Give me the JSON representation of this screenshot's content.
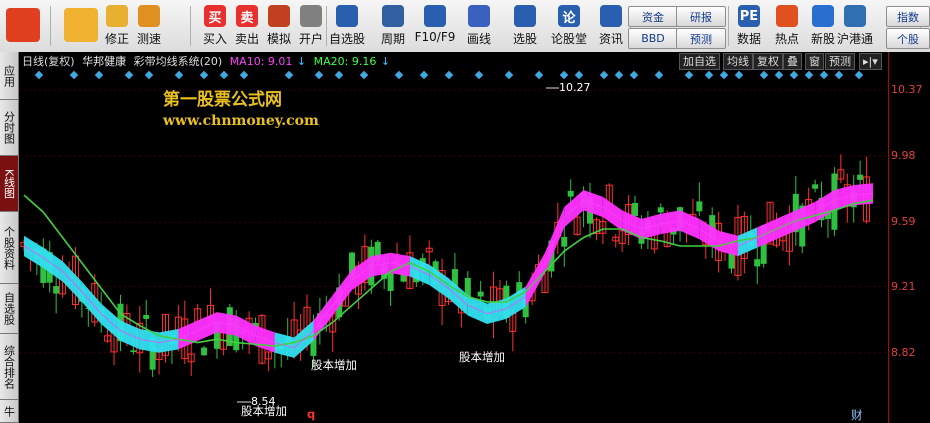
{
  "toolbar": {
    "buttons": [
      {
        "label": "",
        "icon": "app-grid-icon"
      },
      {
        "label": "",
        "icon": "back-arrow-icon"
      },
      {
        "label": "修正",
        "icon": "up-down-icon"
      },
      {
        "label": "测速",
        "icon": "speed-icon"
      },
      {
        "label": "买入",
        "icon": "buy-icon",
        "glyph": "买"
      },
      {
        "label": "卖出",
        "icon": "sell-icon",
        "glyph": "卖"
      },
      {
        "label": "模拟",
        "icon": "hammer-icon"
      },
      {
        "label": "开户",
        "icon": "lock-icon"
      },
      {
        "label": "自选股",
        "icon": "star-icon"
      },
      {
        "label": "周期",
        "icon": "clock-icon"
      },
      {
        "label": "F10/F9",
        "icon": "f10-icon"
      },
      {
        "label": "画线",
        "icon": "pen-icon"
      },
      {
        "label": "选股",
        "icon": "select-stock-icon"
      },
      {
        "label": "论股堂",
        "icon": "forum-icon",
        "glyph": "论"
      },
      {
        "label": "资讯",
        "icon": "news-icon"
      },
      {
        "label": "数据",
        "icon": "pe-icon",
        "glyph": "PE"
      },
      {
        "label": "热点",
        "icon": "hot-icon"
      },
      {
        "label": "新股",
        "icon": "new-stock-icon"
      },
      {
        "label": "沪港通",
        "icon": "sse-hkex-icon"
      }
    ],
    "small_buttons": [
      "资金",
      "BBD",
      "研报",
      "预测",
      "指数",
      "个股"
    ]
  },
  "left_tabs": [
    "应用",
    "分时图",
    "K线图",
    "个股资料",
    "自选股",
    "综合排名",
    "牛"
  ],
  "chart_header": {
    "period": "日线(复权)",
    "stock": "华邦健康",
    "indicator": "彩带均线系统(20)",
    "ma10_label": "MA10: 9.01",
    "ma10_arrow": "↓",
    "ma20_label": "MA20: 9.16",
    "ma20_arrow": "↓",
    "right_buttons": [
      "加自选",
      "均线",
      "复权",
      "叠",
      "窗",
      "预测"
    ],
    "colors": {
      "ma10": "#ff40ff",
      "ma20": "#40ff40",
      "up": "#ff3030",
      "down": "#00c8c8"
    }
  },
  "watermark": {
    "line1": "第一股票公式网",
    "line2": "www.chnmoney.com"
  },
  "annotations": {
    "high_label": "10.27",
    "low_label": "8.54",
    "event1": "股本增加",
    "event2": "股本增加",
    "event3": "股本增加",
    "bottom_q": "q",
    "bottom_cai": "财"
  },
  "chart_data": {
    "type": "line",
    "ylim": [
      8.5,
      10.5
    ],
    "y_ticks": [
      10.37,
      9.98,
      9.59,
      9.21,
      8.82
    ],
    "series": [
      {
        "name": "MA10",
        "values": [
          9.45,
          9.38,
          9.3,
          9.18,
          9.05,
          8.95,
          8.9,
          8.88,
          8.9,
          8.95,
          9.0,
          8.98,
          8.92,
          8.88,
          8.85,
          8.95,
          9.1,
          9.25,
          9.33,
          9.35,
          9.33,
          9.28,
          9.2,
          9.1,
          9.05,
          9.08,
          9.15,
          9.35,
          9.62,
          9.72,
          9.68,
          9.6,
          9.55,
          9.58,
          9.6,
          9.55,
          9.48,
          9.45,
          9.5,
          9.55,
          9.6,
          9.65,
          9.72,
          9.75,
          9.76
        ]
      },
      {
        "name": "MA20",
        "values": [
          9.75,
          9.65,
          9.5,
          9.35,
          9.2,
          9.05,
          8.98,
          8.92,
          8.9,
          8.88,
          8.9,
          8.88,
          8.87,
          8.86,
          8.88,
          8.92,
          9.0,
          9.1,
          9.2,
          9.3,
          9.35,
          9.3,
          9.22,
          9.15,
          9.12,
          9.12,
          9.18,
          9.3,
          9.42,
          9.5,
          9.55,
          9.55,
          9.5,
          9.48,
          9.45,
          9.45,
          9.45,
          9.48,
          9.5,
          9.55,
          9.6,
          9.63,
          9.66,
          9.7,
          9.72
        ]
      }
    ]
  }
}
